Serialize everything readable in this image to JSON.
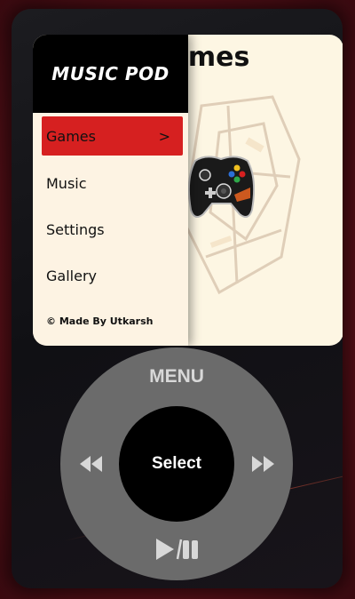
{
  "app": {
    "title": "MUSIC POD"
  },
  "screen": {
    "title": "Games"
  },
  "menu": {
    "items": [
      {
        "label": "Games",
        "active": true
      },
      {
        "label": "Music",
        "active": false
      },
      {
        "label": "Settings",
        "active": false
      },
      {
        "label": "Gallery",
        "active": false
      }
    ],
    "footer": "© Made By Utkarsh"
  },
  "wheel": {
    "menu_label": "MENU",
    "select_label": "Select"
  },
  "icons": {
    "prev": "rewind-icon",
    "next": "fast-forward-icon",
    "play_pause": "play-pause-icon",
    "controller": "game-controller-icon"
  },
  "colors": {
    "active_item": "#d62020",
    "menu_header": "#000000",
    "screen_bg": "#fdf6e3",
    "wheel": "#6b6b6b",
    "wheel_text": "#d8d8d8"
  }
}
